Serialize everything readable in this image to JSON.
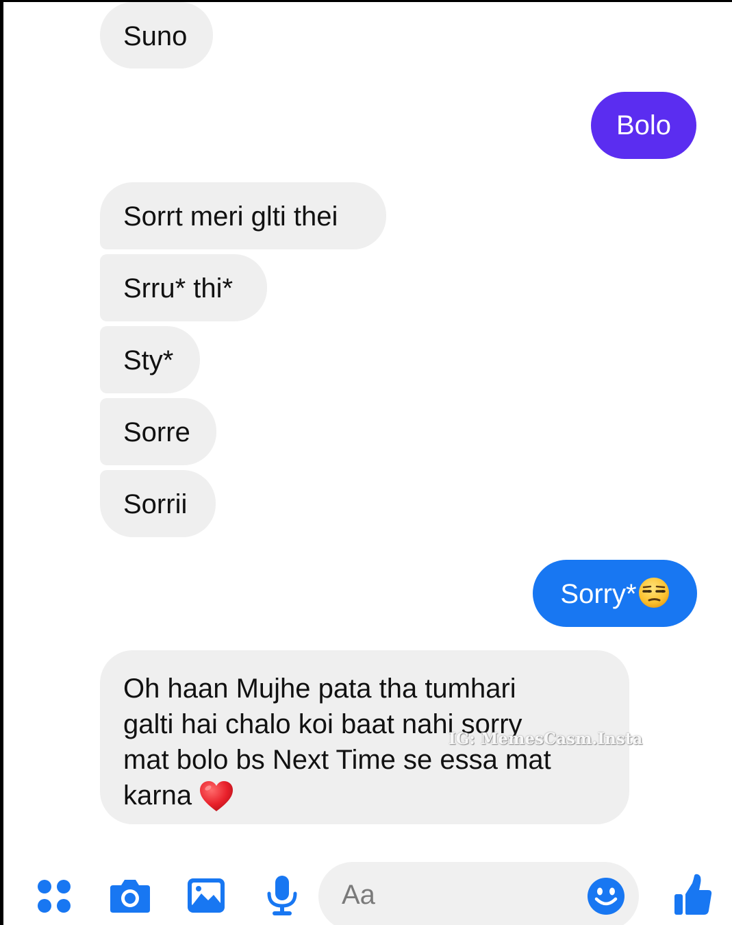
{
  "messages": [
    {
      "id": "m1",
      "direction": "incoming",
      "text": "Suno"
    },
    {
      "id": "m2",
      "direction": "outgoing",
      "text": "Bolo"
    },
    {
      "id": "m3",
      "direction": "incoming",
      "text": "Sorrt meri glti thei"
    },
    {
      "id": "m4",
      "direction": "incoming",
      "text": "Srru* thi*"
    },
    {
      "id": "m5",
      "direction": "incoming",
      "text": "Sty*"
    },
    {
      "id": "m6",
      "direction": "incoming",
      "text": "Sorre"
    },
    {
      "id": "m7",
      "direction": "incoming",
      "text": "Sorrii"
    },
    {
      "id": "m8",
      "direction": "outgoing",
      "text": "Sorry*",
      "emoji": "unamused-face"
    },
    {
      "id": "m9",
      "direction": "incoming",
      "lines": [
        "Oh haan Mujhe pata tha tumhari",
        "galti hai chalo koi baat nahi sorry",
        "mat bolo bs Next Time se essa mat",
        "karna"
      ],
      "emoji": "red-heart"
    }
  ],
  "watermark": "IG: MemesCasm.Insta",
  "composer": {
    "placeholder": "Aa",
    "icons": [
      "menu-dots-icon",
      "camera-icon",
      "image-icon",
      "microphone-icon",
      "emoji-icon",
      "thumbs-up-icon"
    ]
  },
  "colors": {
    "incoming_bubble": "#efefef",
    "outgoing_bubble_first": "#5b2df0",
    "outgoing_bubble_second": "#1877f2",
    "accent": "#1877f2"
  }
}
